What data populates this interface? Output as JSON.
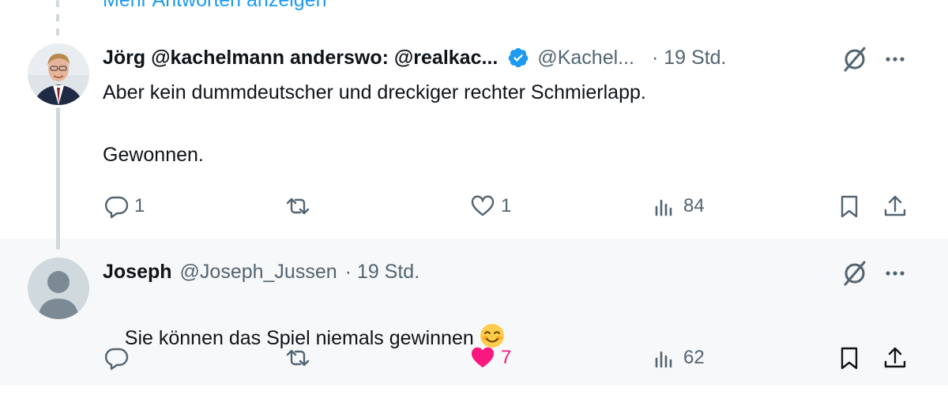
{
  "thread": {
    "show_more_replies": "Mehr Antworten anzeigen"
  },
  "tweets": [
    {
      "author_name": "Jörg @kachelmann anderswo: @realkac...",
      "handle": "@Kachel...",
      "time": "· 19 Std.",
      "verified": true,
      "text_line1": "Aber kein dummdeutscher und dreckiger rechter Schmierlapp.",
      "text_line2": "Gewonnen.",
      "replies": "1",
      "reposts": "",
      "likes": "1",
      "views": "84",
      "liked": false
    },
    {
      "author_name": "Joseph",
      "handle": "@Joseph_Jussen",
      "time": "· 19 Std.",
      "verified": false,
      "text": "Sie können das Spiel niemals gewinnen",
      "emoji": "smiling-face-with-smiling-eyes",
      "replies": "",
      "reposts": "",
      "likes": "7",
      "views": "62",
      "liked": true
    }
  ],
  "colors": {
    "text": "#0f1419",
    "secondary": "#536471",
    "link": "#1d9bf0",
    "verified": "#1d9bf0",
    "like_active": "#f91880",
    "thread_line": "#cfd9de",
    "highlight_bg": "#f7f8f9"
  },
  "icons": [
    "reply-icon",
    "repost-icon",
    "like-icon",
    "views-icon",
    "bookmark-icon",
    "share-icon",
    "grok-icon",
    "more-icon",
    "verified-badge-icon"
  ]
}
